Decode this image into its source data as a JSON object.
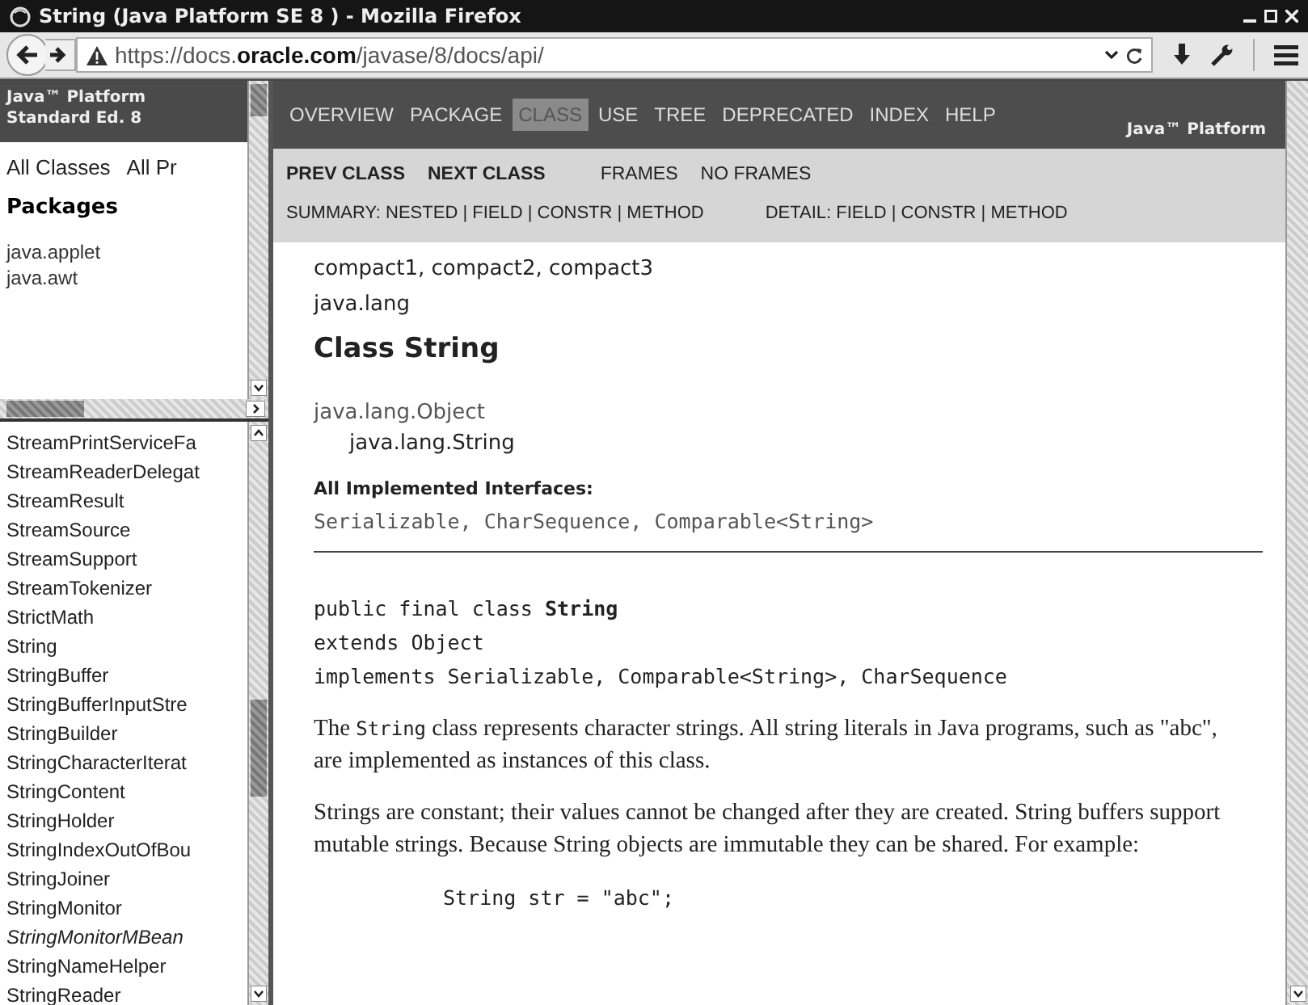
{
  "window": {
    "title": "String (Java Platform SE 8 ) - Mozilla Firefox"
  },
  "address_bar": {
    "prefix": "https://docs.",
    "domain": "oracle.com",
    "path": "/javase/8/docs/api/"
  },
  "packages_frame": {
    "header": [
      "Java™ Platform",
      "Standard Ed. 8"
    ],
    "links": [
      "All Classes",
      "All Pr"
    ],
    "title": "Packages",
    "items": [
      "java.applet",
      "java.awt"
    ]
  },
  "classes_frame": {
    "items": [
      {
        "name": "StreamPrintServiceFa",
        "kind": "class"
      },
      {
        "name": "StreamReaderDelegat",
        "kind": "class"
      },
      {
        "name": "StreamResult",
        "kind": "class"
      },
      {
        "name": "StreamSource",
        "kind": "class"
      },
      {
        "name": "StreamSupport",
        "kind": "class"
      },
      {
        "name": "StreamTokenizer",
        "kind": "class"
      },
      {
        "name": "StrictMath",
        "kind": "class"
      },
      {
        "name": "String",
        "kind": "class"
      },
      {
        "name": "StringBuffer",
        "kind": "class"
      },
      {
        "name": "StringBufferInputStre",
        "kind": "class"
      },
      {
        "name": "StringBuilder",
        "kind": "class"
      },
      {
        "name": "StringCharacterIterat",
        "kind": "class"
      },
      {
        "name": "StringContent",
        "kind": "class"
      },
      {
        "name": "StringHolder",
        "kind": "class"
      },
      {
        "name": "StringIndexOutOfBou",
        "kind": "class"
      },
      {
        "name": "StringJoiner",
        "kind": "class"
      },
      {
        "name": "StringMonitor",
        "kind": "class"
      },
      {
        "name": "StringMonitorMBean",
        "kind": "interface"
      },
      {
        "name": "StringNameHelper",
        "kind": "class"
      },
      {
        "name": "StringReader",
        "kind": "class"
      }
    ]
  },
  "nav": {
    "items": [
      {
        "label": "OVERVIEW",
        "selected": false
      },
      {
        "label": "PACKAGE",
        "selected": false
      },
      {
        "label": "CLASS",
        "selected": true
      },
      {
        "label": "USE",
        "selected": false
      },
      {
        "label": "TREE",
        "selected": false
      },
      {
        "label": "DEPRECATED",
        "selected": false
      },
      {
        "label": "INDEX",
        "selected": false
      },
      {
        "label": "HELP",
        "selected": false
      }
    ],
    "brand": "Java™ Platform"
  },
  "subnav": {
    "links": [
      {
        "label": "PREV CLASS",
        "bold": true
      },
      {
        "label": "NEXT CLASS",
        "bold": true
      },
      {
        "label": "FRAMES",
        "bold": false
      },
      {
        "label": "NO FRAMES",
        "bold": false
      }
    ],
    "summary": "SUMMARY: NESTED | FIELD | CONSTR | METHOD",
    "detail": "DETAIL: FIELD | CONSTR | METHOD"
  },
  "content": {
    "profiles": "compact1, compact2, compact3",
    "package": "java.lang",
    "title": "Class String",
    "hierarchy": [
      "java.lang.Object",
      "java.lang.String"
    ],
    "interfaces_label": "All Implemented Interfaces:",
    "interfaces": "Serializable, CharSequence, Comparable<String>",
    "declaration": [
      "public final class **String**",
      "extends Object",
      "implements Serializable, Comparable<String>, CharSequence"
    ],
    "paragraphs": [
      [
        {
          "text": "The ",
          "code": false
        },
        {
          "text": "String",
          "code": true
        },
        {
          "text": " class represents character strings. All string literals in Java programs, such as \"abc\", are implemented as instances of this class.",
          "code": false
        }
      ],
      [
        {
          "text": "Strings are constant; their values cannot be changed after they are created. String buffers support mutable strings. Because String objects are immutable they can be shared. For example:",
          "code": false
        }
      ]
    ],
    "code": "String str = \"abc\";"
  }
}
